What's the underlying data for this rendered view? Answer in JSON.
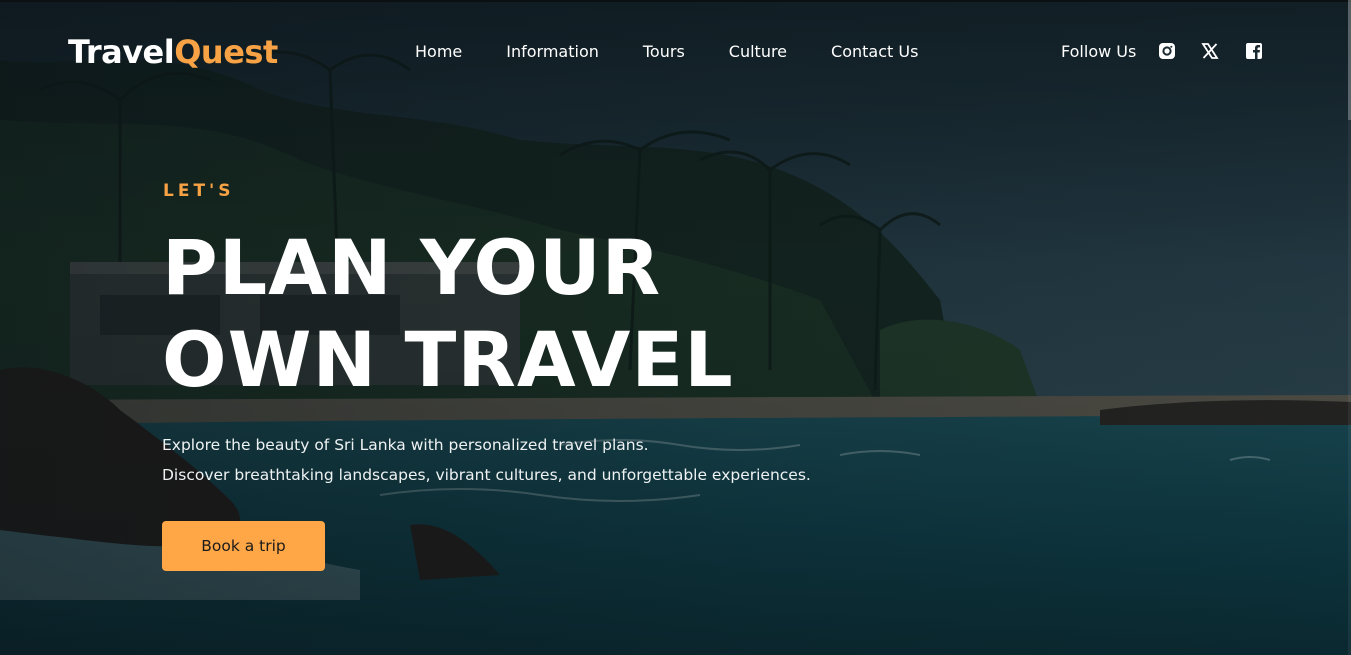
{
  "brand": {
    "part1": "Travel",
    "part2": "Quest",
    "accent_color": "#f7a345"
  },
  "nav": {
    "links": [
      {
        "label": "Home"
      },
      {
        "label": "Information"
      },
      {
        "label": "Tours"
      },
      {
        "label": "Culture"
      },
      {
        "label": "Contact Us"
      }
    ],
    "follow_label": "Follow Us",
    "social_icons": [
      "instagram-icon",
      "x-icon",
      "facebook-icon"
    ]
  },
  "hero": {
    "kicker": "LET'S",
    "headline_line1": "PLAN YOUR",
    "headline_line2": "OWN TRAVEL",
    "lead_line1": "Explore the beauty of Sri Lanka with personalized travel plans.",
    "lead_line2": "Discover breathtaking landscapes, vibrant cultures, and unforgettable experiences.",
    "cta_label": "Book a trip",
    "cta_color": "#ffa646"
  }
}
